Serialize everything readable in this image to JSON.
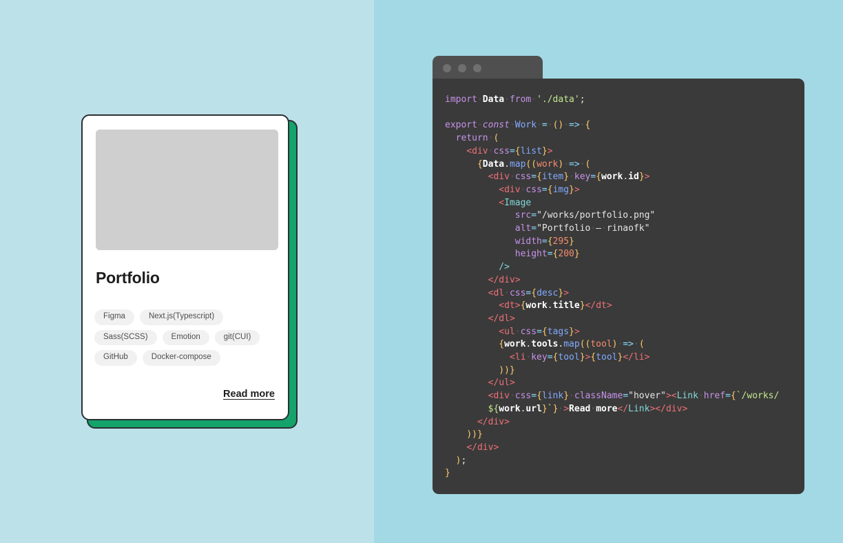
{
  "page": {
    "background_left": "#bde1e9",
    "background_right": "#a2d9e5"
  },
  "card": {
    "title": "Portfolio",
    "accent_color": "#13a36b",
    "border_color": "#2b2f33",
    "thumbnail_placeholder_color": "#cfcfcf",
    "tags": [
      "Figma",
      "Next.js(Typescript)",
      "Sass(SCSS)",
      "Emotion",
      "git(CUI)",
      "GitHub",
      "Docker-compose"
    ],
    "read_more_label": "Read more"
  },
  "code_window": {
    "titlebar_color": "#4f4f4f",
    "body_color": "#3a3a3a",
    "dots": [
      "window-dot-1",
      "window-dot-2",
      "window-dot-3"
    ],
    "language": "jsx",
    "lines": [
      "import Data from './data';",
      "",
      "export const Work = () => {",
      "  return (",
      "    <div css={list}>",
      "      {Data.map((work) => (",
      "        <div css={item} key={work.id}>",
      "          <div css={img}>",
      "          <Image",
      "             src=\"/works/portfolio.png\"",
      "             alt=\"Portfolio – rinaofk\"",
      "             width={295}",
      "             height={200}",
      "          />",
      "        </div>",
      "        <dl css={desc}>",
      "          <dt>{work.title}</dt>",
      "        </dl>",
      "          <ul css={tags}>",
      "          {work.tools.map((tool) => (",
      "            <li key={tool}>{tool}</li>",
      "          ))}",
      "        </ul>",
      "        <div css={link} className=\"hover\"><Link href={`/works/",
      "        ${work.url}`} >Read more</Link></div>",
      "      </div>",
      "    ))}",
      "    </div>",
      "  );",
      "}"
    ]
  }
}
